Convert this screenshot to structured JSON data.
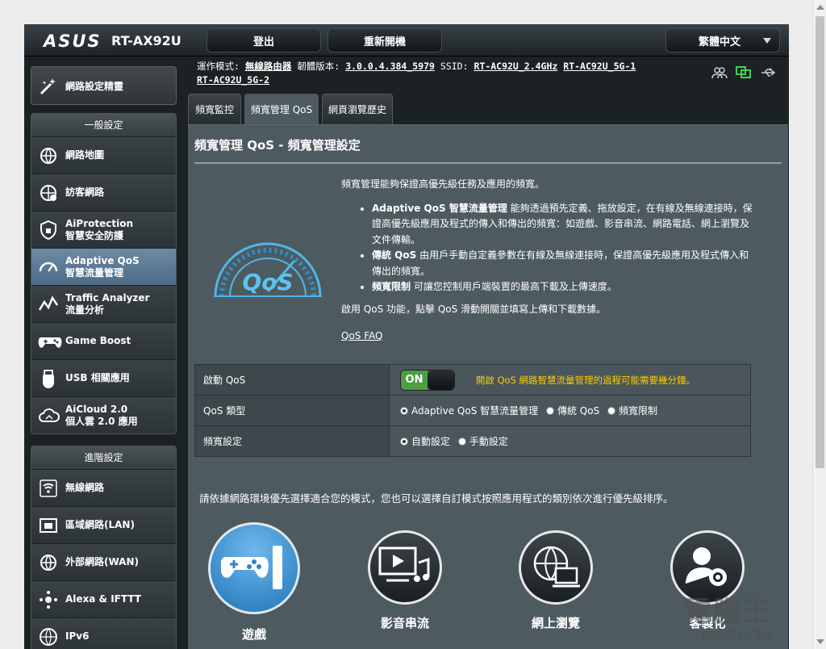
{
  "header": {
    "logo": "ASUS",
    "model": "RT-AX92U",
    "logout_label": "登出",
    "reboot_label": "重新開機",
    "language_label": "繁體中文"
  },
  "info": {
    "mode_label": "運作模式:",
    "mode_value": "無線路由器",
    "firmware_label": "韌體版本:",
    "firmware_value": "3.0.0.4.384_5979",
    "ssid_label": "SSID:",
    "ssid_1": "RT-AC92U_2.4GHz",
    "ssid_2": "RT-AC92U_5G-1",
    "ssid_3": "RT-AC92U_5G-2"
  },
  "sidebar": {
    "setup_wizard": "網路設定精靈",
    "general_heading": "一般設定",
    "general_items": [
      {
        "label": "網路地圖",
        "sub": "",
        "icon": "globe-network-icon"
      },
      {
        "label": "訪客網路",
        "sub": "",
        "icon": "guest-network-icon"
      },
      {
        "label": "AiProtection",
        "sub": "智慧安全防護",
        "icon": "shield-icon"
      },
      {
        "label": "Adaptive QoS",
        "sub": "智慧流量管理",
        "icon": "qos-gauge-icon"
      },
      {
        "label": "Traffic Analyzer",
        "sub": "流量分析",
        "icon": "traffic-chart-icon"
      },
      {
        "label": "Game Boost",
        "sub": "",
        "icon": "gamepad-icon"
      },
      {
        "label": "USB 相關應用",
        "sub": "",
        "icon": "usb-icon"
      },
      {
        "label": "AiCloud 2.0",
        "sub": "個人雲 2.0 應用",
        "icon": "cloud-icon"
      }
    ],
    "advanced_heading": "進階設定",
    "advanced_items": [
      {
        "label": "無線網路",
        "sub": "",
        "icon": "wifi-icon"
      },
      {
        "label": "區域網路(LAN)",
        "sub": "",
        "icon": "lan-icon"
      },
      {
        "label": "外部網路(WAN)",
        "sub": "",
        "icon": "wan-globe-icon"
      },
      {
        "label": "Alexa & IFTTT",
        "sub": "",
        "icon": "alexa-icon"
      },
      {
        "label": "IPv6",
        "sub": "",
        "icon": "ipv6-icon"
      }
    ]
  },
  "tabs": [
    "頻寬監控",
    "頻寬管理 QoS",
    "網頁瀏覽歷史"
  ],
  "panel": {
    "title": "頻寬管理 QoS - 頻寬管理設定",
    "intro": "頻寬管理能夠保證高優先級任務及應用的頻寬。",
    "bullets": [
      {
        "bold": "Adaptive QoS 智慧流量管理",
        "text": " 能夠透過預先定義、拖放設定，在有線及無線連接時，保證高優先級應用及程式的傳入和傳出的頻寬：如遊戲、影音串流、網路電話、網上瀏覽及文件傳輸。"
      },
      {
        "bold": "傳統 QoS",
        "text": " 由用戶手動自定義參數在有線及無線連接時，保證高優先級應用及程式傳入和傳出的頻寬。"
      },
      {
        "bold": "頻寬限制",
        "text": " 可讓您控制用戶端裝置的最高下載及上傳速度。"
      }
    ],
    "enable_text": "啟用 QoS 功能，點擊 QoS 滑動開關並填寫上傳和下載數據。",
    "faq_link": "QoS FAQ",
    "gauge_text": "QoS"
  },
  "settings": {
    "enable_label": "啟動 QoS",
    "toggle_on": "ON",
    "warning": "開啟 QoS 網路智慧流量管理的過程可能需要幾分鐘。",
    "type_label": "QoS 類型",
    "type_options": [
      "Adaptive QoS 智慧流量管理",
      "傳統 QoS",
      "頻寬限制"
    ],
    "type_selected": 0,
    "bandwidth_label": "頻寬設定",
    "bandwidth_options": [
      "自動設定",
      "手動設定"
    ],
    "bandwidth_selected": 0
  },
  "modes": {
    "hint": "請依據網路環境優先選擇適合您的模式，您也可以選擇自訂模式按照應用程式的類別依次進行優先級排序。",
    "items": [
      {
        "label": "遊戲",
        "icon": "gamepad-icon",
        "active": true
      },
      {
        "label": "影音串流",
        "icon": "media-streaming-icon",
        "active": false
      },
      {
        "label": "網上瀏覽",
        "icon": "web-browsing-icon",
        "active": false
      },
      {
        "label": "客製化",
        "icon": "custom-user-gear-icon",
        "active": false
      }
    ]
  },
  "watermark": {
    "line1": "電腦王",
    "line2": "pcadv.tw"
  },
  "colors": {
    "accent_on": "#4ba042",
    "warning": "#ffcc00",
    "active_mode": "#1f74b8",
    "panel": "#4d5a60"
  }
}
